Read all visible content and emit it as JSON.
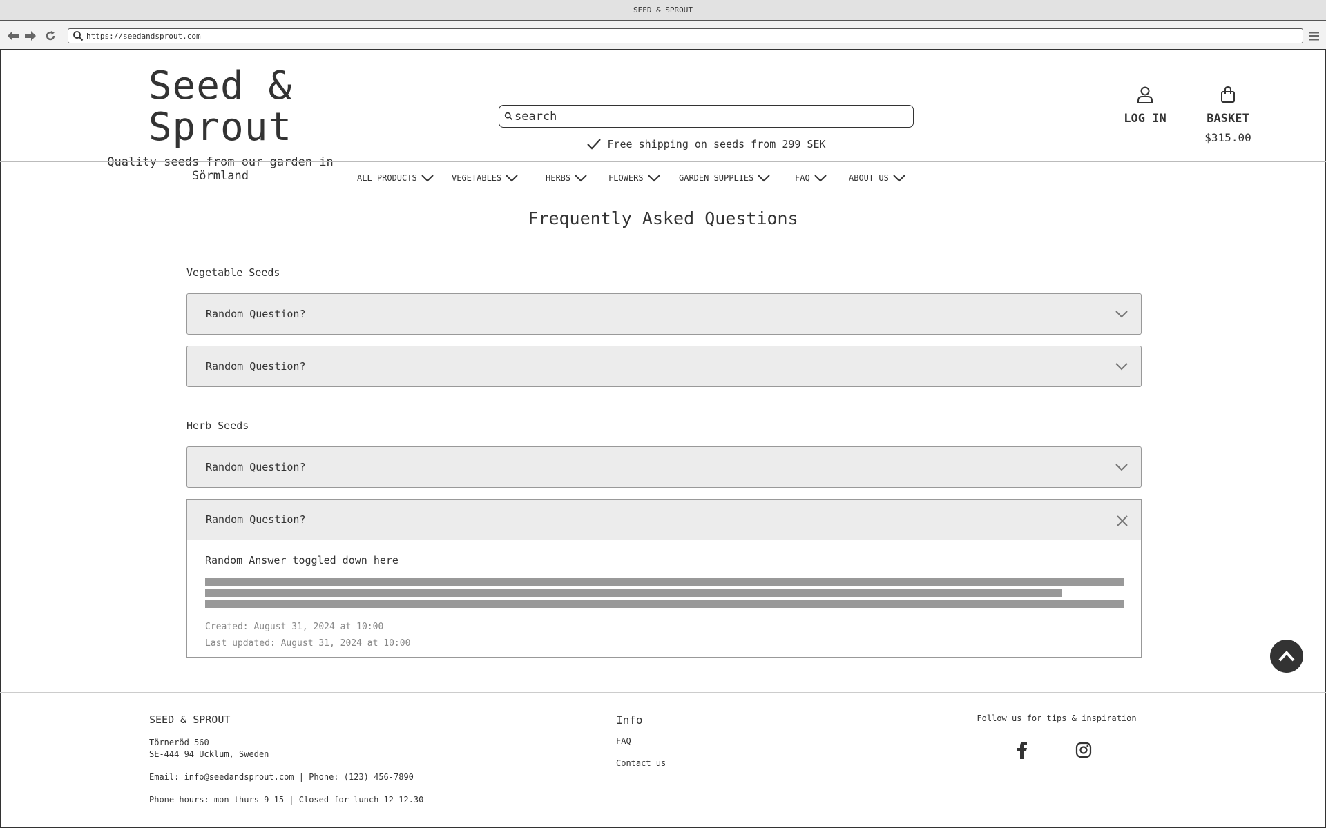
{
  "browser": {
    "title": "SEED & SPROUT",
    "url": "https://seedandsprout.com"
  },
  "header": {
    "brand_title": "Seed & Sprout",
    "tagline": "Quality seeds from our garden in Sörmland",
    "search_placeholder": "search",
    "shipping_note": "Free shipping on seeds from 299 SEK",
    "login_label": "LOG IN",
    "basket_label": "BASKET",
    "basket_total": "$315.00"
  },
  "nav": {
    "items": [
      "ALL PRODUCTS",
      "VEGETABLES",
      "HERBS",
      "FLOWERS",
      "GARDEN SUPPLIES",
      "FAQ",
      "ABOUT US"
    ]
  },
  "faq": {
    "title": "Frequently Asked Questions",
    "sections": [
      {
        "heading": "Vegetable Seeds",
        "questions": [
          "Random Question?",
          "Random Question?"
        ]
      },
      {
        "heading": "Herb Seeds",
        "questions": [
          "Random Question?",
          "Random Question?"
        ]
      }
    ],
    "open_answer": {
      "title": "Random Answer toggled down here",
      "created": "Created: August 31, 2024 at 10:00",
      "updated": "Last updated: August 31, 2024 at 10:00"
    }
  },
  "footer": {
    "brand": "SEED & SPROUT",
    "address_line1": "Törneröd 560",
    "address_line2": "SE-444 94 Ucklum, Sweden",
    "contact": "Email: info@seedandsprout.com | Phone: (123) 456-7890",
    "hours": "Phone hours: mon-thurs 9-15 | Closed for lunch 12-12.30",
    "info_heading": "Info",
    "links": [
      "FAQ",
      "Contact us"
    ],
    "follow": "Follow us for tips & inspiration"
  },
  "icons": {
    "back": "arrow-left-icon",
    "forward": "arrow-right-icon",
    "reload": "reload-icon",
    "menu": "hamburger-icon",
    "search": "search-icon",
    "check": "checkmark-icon",
    "user": "user-icon",
    "bag": "shopping-bag-icon",
    "chevron": "chevron-down-icon",
    "close": "close-icon",
    "totop": "chevron-up-icon",
    "facebook": "facebook-icon",
    "instagram": "instagram-icon"
  }
}
